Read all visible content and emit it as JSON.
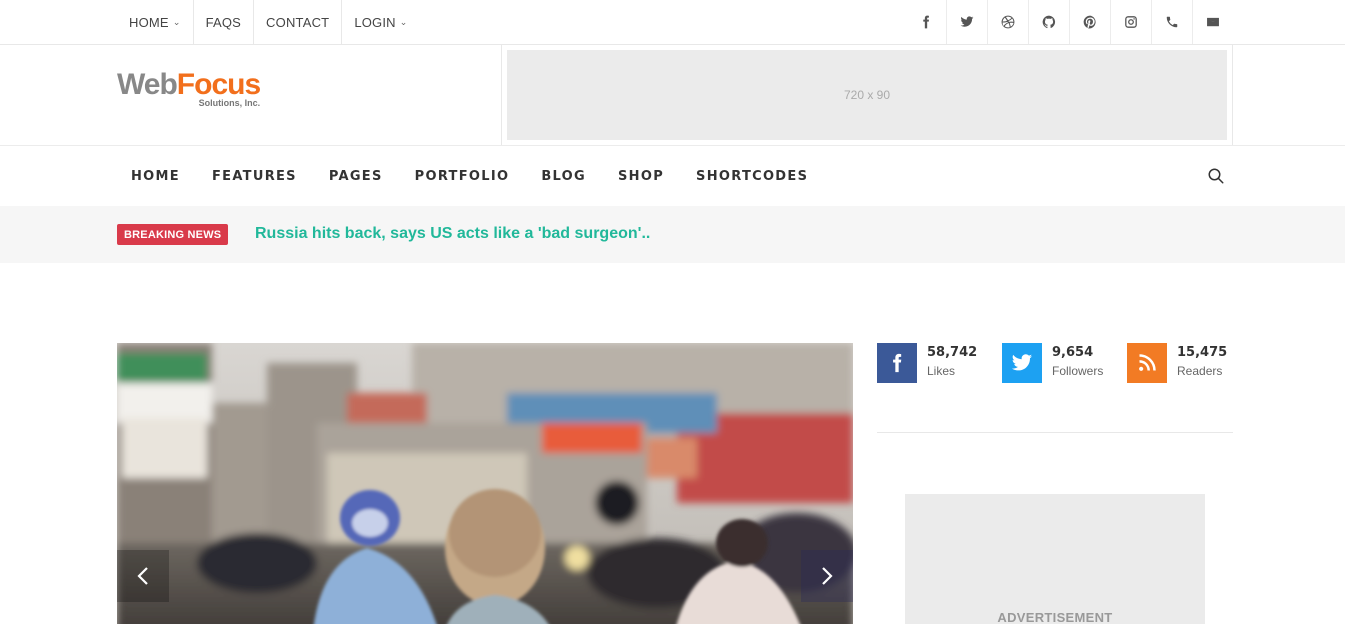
{
  "topnav": [
    {
      "label": "HOME",
      "has_dropdown": true
    },
    {
      "label": "FAQS",
      "has_dropdown": false
    },
    {
      "label": "CONTACT",
      "has_dropdown": false
    },
    {
      "label": "LOGIN",
      "has_dropdown": true
    }
  ],
  "socials": [
    "facebook-icon",
    "twitter-icon",
    "dribbble-icon",
    "github-icon",
    "pinterest-icon",
    "instagram-icon",
    "phone-icon",
    "mail-icon"
  ],
  "logo": {
    "part1": "Web",
    "part2": "Focus",
    "tagline": "Solutions, Inc."
  },
  "banner_ad": {
    "label": "720 x 90"
  },
  "mainnav": [
    "HOME",
    "FEATURES",
    "PAGES",
    "PORTFOLIO",
    "BLOG",
    "SHOP",
    "SHORTCODES"
  ],
  "breaking": {
    "badge": "BREAKING NEWS",
    "headline": "Russia hits back, says US acts like a 'bad surgeon'.."
  },
  "counters": [
    {
      "network": "facebook",
      "icon": "facebook-icon",
      "color": "#3b5998",
      "count": "58,742",
      "label": "Likes"
    },
    {
      "network": "twitter",
      "icon": "twitter-icon",
      "color": "#1da1f2",
      "count": "9,654",
      "label": "Followers"
    },
    {
      "network": "rss",
      "icon": "rss-icon",
      "color": "#f27b24",
      "count": "15,475",
      "label": "Readers"
    }
  ],
  "sidebar_ad": {
    "label": "ADVERTISEMENT"
  },
  "colors": {
    "accent": "#21b89a",
    "breaking_badge": "#d93a4a",
    "logo_orange": "#f26f1c"
  }
}
